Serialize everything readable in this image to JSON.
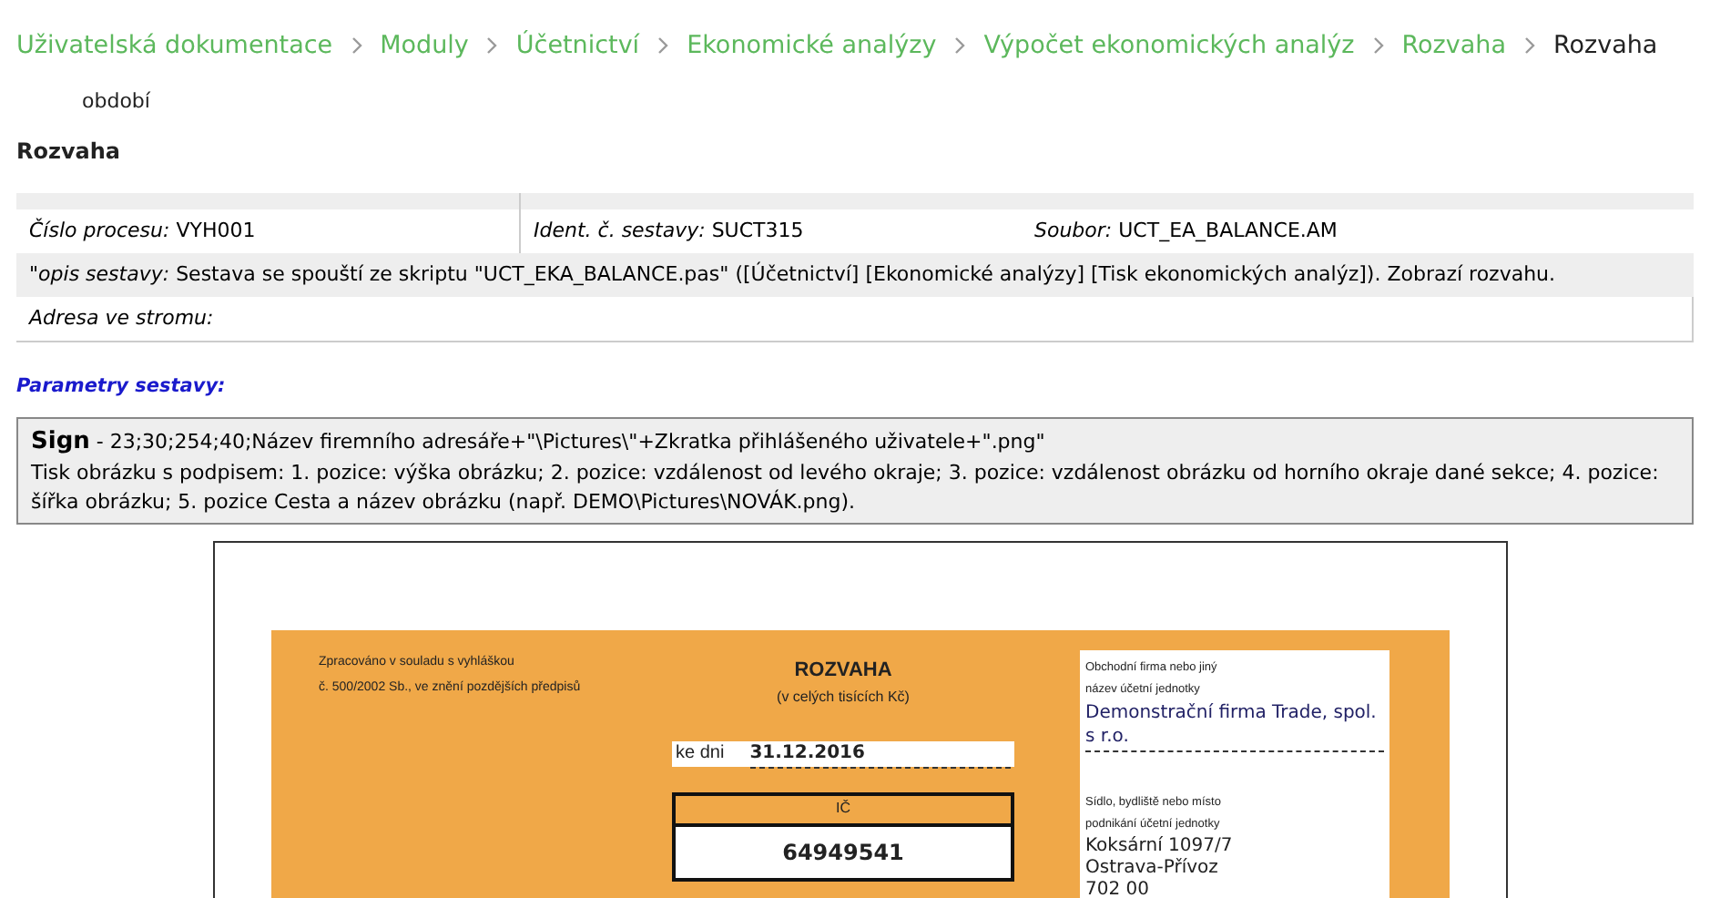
{
  "breadcrumb": [
    {
      "label": "Uživatelská dokumentace",
      "current": false
    },
    {
      "label": "Moduly",
      "current": false
    },
    {
      "label": "Účetnictví",
      "current": false
    },
    {
      "label": "Ekonomické analýzy",
      "current": false
    },
    {
      "label": "Výpočet ekonomických analýz",
      "current": false
    },
    {
      "label": "Rozvaha",
      "current": false
    },
    {
      "label": "Rozvaha",
      "current": true
    }
  ],
  "cut_text": "období",
  "heading": "Rozvaha",
  "info": {
    "process": {
      "label": "Číslo procesu:",
      "value": "VYH001"
    },
    "ident": {
      "label": "Ident. č. sestavy:",
      "value": "SUCT315"
    },
    "file": {
      "label": "Soubor:",
      "value": "UCT_EA_BALANCE.AM"
    },
    "description": {
      "label": "\"opis sestavy:",
      "value": "Sestava se spouští ze skriptu \"UCT_EKA_BALANCE.pas\" ([Účetnictví] [Ekonomické analýzy] [Tisk ekonomických analýz]). Zobrazí rozvahu."
    },
    "tree": {
      "label": "Adresa ve stromu:"
    }
  },
  "params_title": "Parametry sestavy:",
  "param": {
    "name": "Sign",
    "value": "- 23;30;254;40;Název firemního adresáře+\"\\Pictures\\\"+Zkratka přihlášeného uživatele+\".png\"",
    "description": "Tisk obrázku s podpisem: 1. pozice: výška obrázku; 2. pozice: vzdálenost od levého okraje; 3. pozice: vzdálenost obrázku od horního okraje dané sekce; 4. pozice: šířka obrázku; 5. pozice Cesta a název obrázku (např. DEMO\\Pictures\\NOVÁK.png)."
  },
  "document": {
    "note_line_1": "Zpracováno v souladu s vyhláškou",
    "note_line_2": "č. 500/2002 Sb., ve znění pozdějších předpisů",
    "title": "ROZVAHA",
    "subtitle": "(v celých tisících Kč)",
    "date_label": "ke dni",
    "date": "31.12.2016",
    "ic_label": "IČ",
    "ic": "64949541",
    "company_label_1": "Obchodní firma nebo jiný",
    "company_label_2": "název účetní jednotky",
    "company": "Demonstrační firma Trade, spol. s r.o.",
    "seat_label_1": "Sídlo, bydliště nebo místo",
    "seat_label_2": "podnikání účetní jednotky",
    "address": [
      "Koksární 1097/7",
      "Ostrava-Přívoz",
      "702 00"
    ]
  }
}
